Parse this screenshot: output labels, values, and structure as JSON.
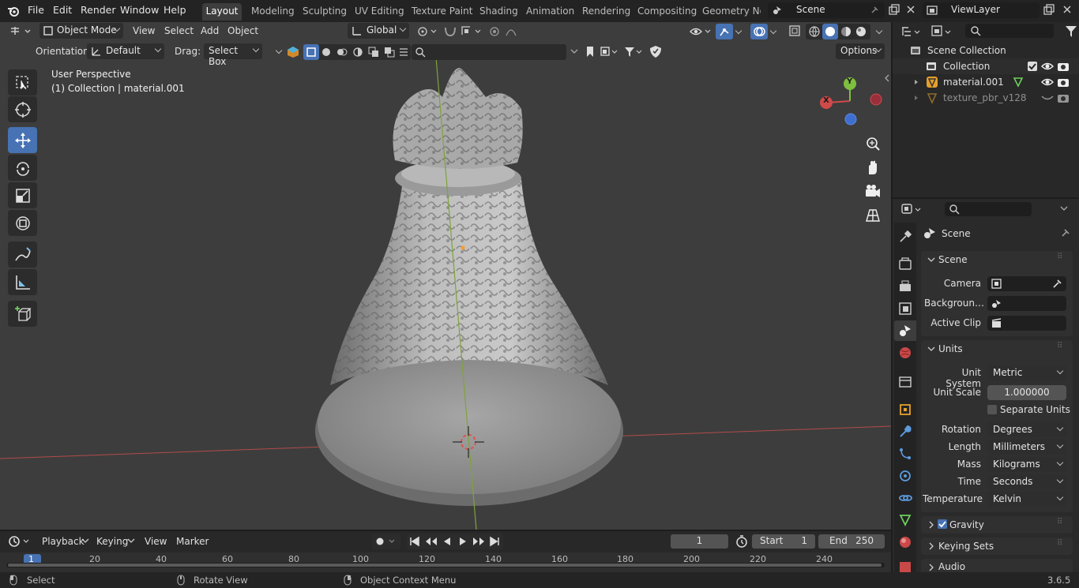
{
  "menubar": {
    "items": [
      "File",
      "Edit",
      "Render",
      "Window",
      "Help"
    ],
    "workspaces": [
      "Layout",
      "Modeling",
      "Sculpting",
      "UV Editing",
      "Texture Paint",
      "Shading",
      "Animation",
      "Rendering",
      "Compositing",
      "Geometry Noc"
    ],
    "active_workspace": "Layout",
    "scene": "Scene",
    "view_layer": "ViewLayer"
  },
  "viewport_header": {
    "mode": "Object Mode",
    "menus": [
      "View",
      "Select",
      "Add",
      "Object"
    ],
    "transform": "Global",
    "orientation_label": "Orientation:",
    "orientation_value": "Default",
    "drag_label": "Drag:",
    "drag_value": "Select Box",
    "options": "Options"
  },
  "viewport": {
    "perspective": "User Perspective",
    "collection_line": "(1) Collection | material.001",
    "gizmo": {
      "x": "X",
      "y": "Y"
    }
  },
  "outliner": {
    "root": "Scene Collection",
    "items": [
      {
        "label": "Collection",
        "checked": true
      },
      {
        "label": "material.001"
      },
      {
        "label": "texture_pbr_v128"
      }
    ]
  },
  "properties": {
    "context": "Scene",
    "scene_panel": {
      "title": "Scene",
      "camera_label": "Camera",
      "background_label": "Backgroun…",
      "active_clip_label": "Active Clip"
    },
    "units_panel": {
      "title": "Units",
      "unit_system_label": "Unit System",
      "unit_system": "Metric",
      "unit_scale_label": "Unit Scale",
      "unit_scale": "1.000000",
      "separate_units": "Separate Units",
      "rotation_label": "Rotation",
      "rotation": "Degrees",
      "length_label": "Length",
      "length": "Millimeters",
      "mass_label": "Mass",
      "mass": "Kilograms",
      "time_label": "Time",
      "time": "Seconds",
      "temperature_label": "Temperature",
      "temperature": "Kelvin"
    },
    "collapsed_panels": [
      "Gravity",
      "Keying Sets",
      "Audio"
    ]
  },
  "timeline": {
    "menus": [
      "Playback",
      "Keying",
      "View",
      "Marker"
    ],
    "current_frame": "1",
    "start_label": "Start",
    "start": "1",
    "end_label": "End",
    "end": "250",
    "ticks": [
      "1",
      "20",
      "40",
      "60",
      "80",
      "100",
      "120",
      "140",
      "160",
      "180",
      "200",
      "220",
      "240"
    ]
  },
  "statusbar": {
    "select": "Select",
    "rotate": "Rotate View",
    "context_menu": "Object Context Menu",
    "version": "3.6.5"
  },
  "colors": {
    "accent": "#4772b3",
    "viewport_bg": "#3d3d3d",
    "x_axis": "#d04a4a",
    "y_axis": "#7fbf3f",
    "z_axis": "#3e6fd0"
  }
}
